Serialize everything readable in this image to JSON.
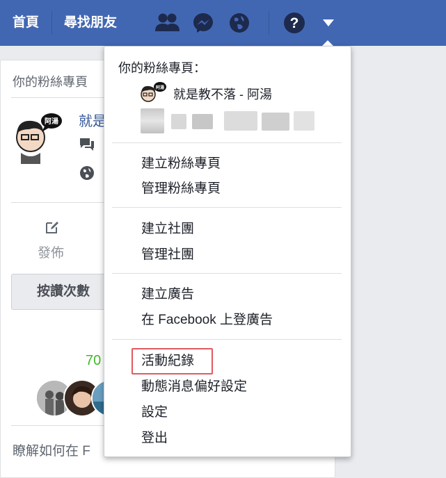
{
  "topbar": {
    "home": "首頁",
    "find_friends": "尋找朋友",
    "colors": {
      "bar": "#4267b2",
      "icon": "#1d2a4e"
    }
  },
  "card": {
    "title": "你的粉絲專頁",
    "page_name_partial": "就是",
    "post_label": "發佈",
    "like_button": "按讚次數",
    "count_partial": "70",
    "bottom_partial": "瞭解如何在 F"
  },
  "menu": {
    "header": "你的粉絲專頁：",
    "page_name": "就是教不落 - 阿湯",
    "group1": [
      "建立粉絲專頁",
      "管理粉絲專頁"
    ],
    "group2": [
      "建立社團",
      "管理社團"
    ],
    "group3": [
      "建立廣告",
      "在 Facebook 上登廣告"
    ],
    "group4": [
      "活動紀錄",
      "動態消息偏好設定",
      "設定",
      "登出"
    ],
    "highlighted": "活動紀錄",
    "highlight_color": "#e0595e"
  }
}
